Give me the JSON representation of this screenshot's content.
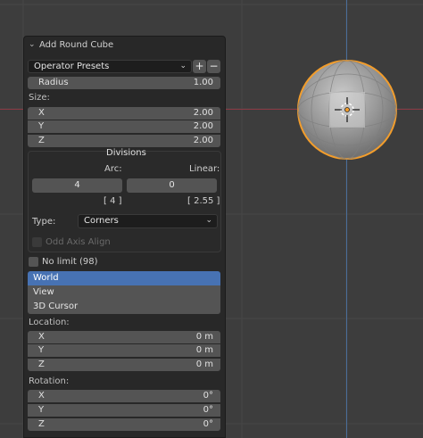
{
  "panel": {
    "title": "Add Round Cube",
    "presets_label": "Operator Presets",
    "add_preset": "+",
    "remove_preset": "−",
    "radius_label": "Radius",
    "radius_value": "1.00",
    "size_label": "Size:",
    "size": [
      {
        "label": "X",
        "value": "2.00"
      },
      {
        "label": "Y",
        "value": "2.00"
      },
      {
        "label": "Z",
        "value": "2.00"
      }
    ],
    "divisions_label": "Divisions",
    "arc_label": "Arc:",
    "linear_label": "Linear:",
    "arc_value": "4",
    "linear_value": "0",
    "arc_bracket": "[ 4 ]",
    "linear_bracket": "[ 2.55 ]",
    "type_label": "Type:",
    "type_value": "Corners",
    "odd_axis_label": "Odd Axis Align",
    "no_limit_label": "No limit (98)",
    "align_options": [
      "World",
      "View",
      "3D Cursor"
    ],
    "align_selected": "World",
    "location_label": "Location:",
    "location": [
      {
        "label": "X",
        "value": "0 m"
      },
      {
        "label": "Y",
        "value": "0 m"
      },
      {
        "label": "Z",
        "value": "0 m"
      }
    ],
    "rotation_label": "Rotation:",
    "rotation": [
      {
        "label": "X",
        "value": "0°"
      },
      {
        "label": "Y",
        "value": "0°"
      },
      {
        "label": "Z",
        "value": "0°"
      }
    ]
  },
  "icons": {
    "collapse": "chevron-down-icon",
    "dropdown": "chevron-down-icon",
    "object_origin": "object-origin-icon",
    "cursor": "3d-cursor-icon"
  },
  "colors": {
    "viewport_bg": "#3d3d3d",
    "panel_bg": "#282828",
    "field_bg": "#545454",
    "selected_bg": "#4772b3",
    "x_axis": "#8a3a44",
    "y_axis": "#4a6e9a",
    "selection_outline": "#f29d2c"
  }
}
